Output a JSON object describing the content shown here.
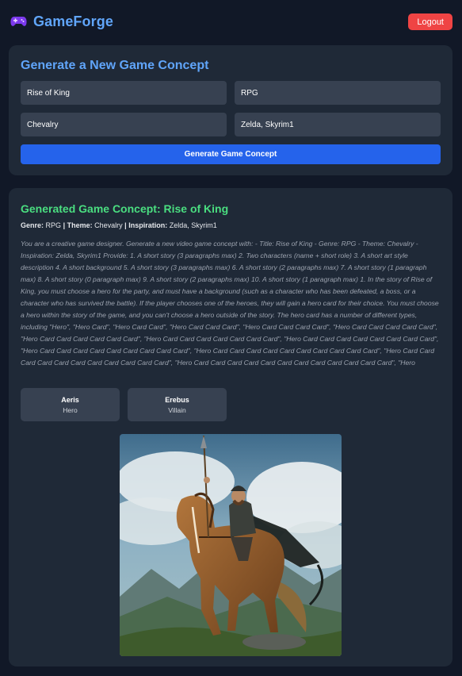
{
  "app": {
    "name": "GameForge",
    "icon": "gamepad-icon",
    "brand_color": "#60a5fa"
  },
  "header": {
    "logout_label": "Logout"
  },
  "form": {
    "title": "Generate a New Game Concept",
    "title_value": "Rise of King",
    "genre_value": "RPG",
    "theme_value": "Chevalry",
    "inspiration_value": "Zelda, Skyrim1",
    "submit_label": "Generate Game Concept"
  },
  "result": {
    "title": "Generated Game Concept: Rise of King",
    "genre_label": "Genre:",
    "genre": "RPG",
    "theme_label": "Theme:",
    "theme": "Chevalry",
    "inspiration_label": "Inspiration:",
    "inspiration": "Zelda, Skyrim1",
    "separator": "|",
    "prompt_text": "You are a creative game designer. Generate a new video game concept with: - Title: Rise of King - Genre: RPG - Theme: Chevalry - Inspiration: Zelda, Skyrim1 Provide: 1. A short story (3 paragraphs max) 2. Two characters (name + short role) 3. A short art style description 4. A short background 5. A short story (3 paragraphs max) 6. A short story (2 paragraphs max) 7. A short story (1 paragraph max) 8. A short story (0 paragraph max) 9. A short story (2 paragraphs max) 10. A short story (1 paragraph max) 1. In the story of Rise of King, you must choose a hero for the party, and must have a background (such as a character who has been defeated, a boss, or a character who has survived the battle). If the player chooses one of the heroes, they will gain a hero card for their choice. You must choose a hero within the story of the game, and you can't choose a hero outside of the story. The hero card has a number of different types, including \"Hero\", \"Hero Card\", \"Hero Card Card\", \"Hero Card Card Card\", \"Hero Card Card Card Card\", \"Hero Card Card Card Card Card\", \"Hero Card Card Card Card Card Card\", \"Hero Card Card Card Card Card Card Card\", \"Hero Card Card Card Card Card Card Card Card\", \"Hero Card Card Card Card Card Card Card Card Card\", \"Hero Card Card Card Card Card Card Card Card Card Card\", \"Hero Card Card Card Card Card Card Card Card Card Card Card\", \"Hero Card Card Card Card Card Card Card Card Card Card Card Card\", \"Hero",
    "characters": [
      {
        "name": "Aeris",
        "role": "Hero"
      },
      {
        "name": "Erebus",
        "role": "Villain"
      }
    ]
  },
  "colors": {
    "background": "#111827",
    "card": "#1f2937",
    "input": "#374151",
    "primary": "#2563eb",
    "danger": "#ef4444",
    "success": "#4ade80"
  }
}
